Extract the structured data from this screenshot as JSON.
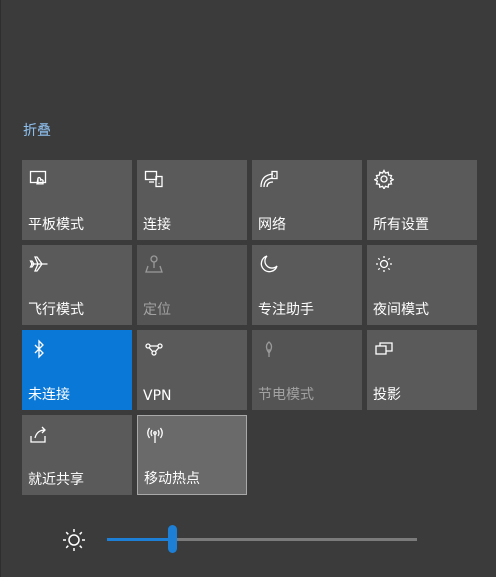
{
  "panel": {
    "collapse_label": "折叠"
  },
  "tiles": [
    {
      "label": "平板模式",
      "icon": "tablet-mode-icon",
      "state": "normal"
    },
    {
      "label": "连接",
      "icon": "connect-icon",
      "state": "normal"
    },
    {
      "label": "网络",
      "icon": "network-icon",
      "state": "normal"
    },
    {
      "label": "所有设置",
      "icon": "settings-gear-icon",
      "state": "normal"
    },
    {
      "label": "飞行模式",
      "icon": "airplane-icon",
      "state": "normal"
    },
    {
      "label": "定位",
      "icon": "location-icon",
      "state": "disabled"
    },
    {
      "label": "专注助手",
      "icon": "moon-icon",
      "state": "normal"
    },
    {
      "label": "夜间模式",
      "icon": "night-light-icon",
      "state": "normal"
    },
    {
      "label": "未连接",
      "icon": "bluetooth-icon",
      "state": "active"
    },
    {
      "label": "VPN",
      "icon": "vpn-icon",
      "state": "normal"
    },
    {
      "label": "节电模式",
      "icon": "battery-saver-icon",
      "state": "disabled"
    },
    {
      "label": "投影",
      "icon": "project-icon",
      "state": "normal"
    },
    {
      "label": "就近共享",
      "icon": "nearby-share-icon",
      "state": "normal"
    },
    {
      "label": "移动热点",
      "icon": "mobile-hotspot-icon",
      "state": "hover"
    }
  ],
  "brightness": {
    "level_percent": 21,
    "icon": "brightness-sun-icon"
  },
  "colors": {
    "accent": "#0a78d7",
    "tile": "#5a5a5a",
    "background": "#3b3b3b",
    "link": "#8fc1f0"
  }
}
